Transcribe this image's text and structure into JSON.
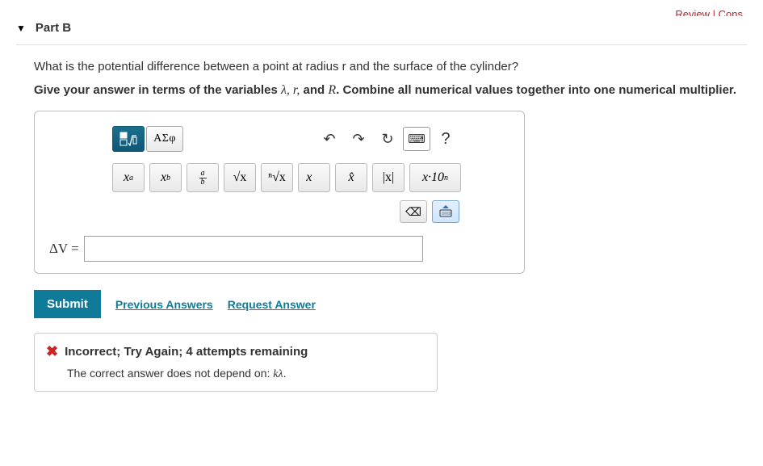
{
  "top_links": "Review | Cons",
  "part": {
    "label": "Part B",
    "caret": "▼"
  },
  "question": "What is the potential difference between a point at radius r and the surface of the cylinder?",
  "instruction": {
    "prefix": "Give your answer in terms of the variables ",
    "vars": "λ, r,",
    "mid": " and ",
    "var2": "R",
    "suffix": ". Combine all numerical values together into one numerical multiplier."
  },
  "toolbar": {
    "mode_math_title": "math mode",
    "mode_greek": "ΑΣφ",
    "undo": "↶",
    "redo": "↷",
    "reset": "↻",
    "keyboard": "⌨",
    "help": "?",
    "tpl": {
      "sup": "x",
      "sup_s": "a",
      "sub": "x",
      "sub_s": "b",
      "frac_n": "a",
      "frac_d": "b",
      "sqrt": "√x",
      "nroot": "ⁿ√x",
      "vec": "x⃗",
      "hat": "x̂",
      "abs": "|x|",
      "sci": "x·10",
      "sci_s": "n"
    },
    "backspace": "⌫",
    "kbd2": "⌨"
  },
  "input": {
    "label": "ΔV =",
    "value": ""
  },
  "actions": {
    "submit": "Submit",
    "prev": "Previous Answers",
    "req": "Request Answer"
  },
  "feedback": {
    "icon": "✖",
    "title": "Incorrect; Try Again; 4 attempts remaining",
    "hint_prefix": "The correct answer does not depend on: ",
    "hint_var": "kλ",
    "hint_suffix": "."
  }
}
